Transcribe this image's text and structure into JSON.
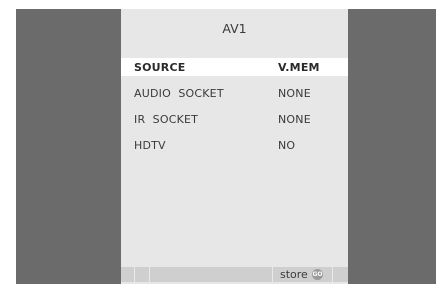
{
  "title": "AV1",
  "menu": [
    {
      "label": "SOURCE",
      "value": "V.MEM",
      "selected": true
    },
    {
      "label": "AUDIO  SOCKET",
      "value": "NONE",
      "selected": false
    },
    {
      "label": "IR  SOCKET",
      "value": "NONE",
      "selected": false
    },
    {
      "label": "HDTV",
      "value": "NO",
      "selected": false
    }
  ],
  "footer": {
    "store_label": "store",
    "go_label": "GO"
  },
  "colors": {
    "background": "#6b6b6b",
    "panel": "#e7e7e7",
    "highlight": "#ffffff",
    "footer_bar": "#cfcfcf",
    "text": "#3a3a3a"
  }
}
